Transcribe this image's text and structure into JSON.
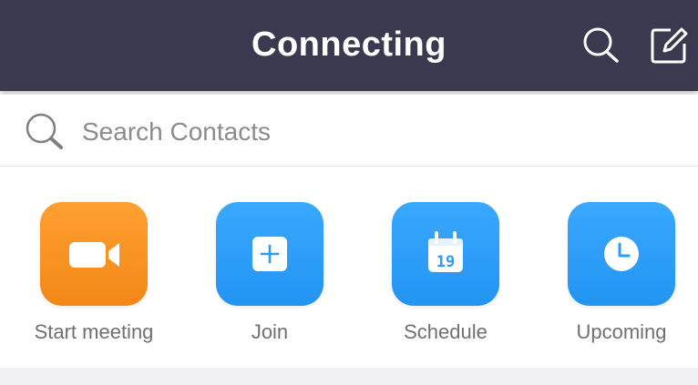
{
  "header": {
    "title": "Connecting",
    "background": "#3b3950",
    "icons": {
      "search": "search-icon",
      "compose": "compose-icon"
    }
  },
  "search": {
    "placeholder": "Search Contacts",
    "value": ""
  },
  "actions": [
    {
      "label": "Start meeting",
      "icon": "video-camera-icon",
      "color": "#f58b1a"
    },
    {
      "label": "Join",
      "icon": "plus-icon",
      "color": "#2b9cf7"
    },
    {
      "label": "Schedule",
      "icon": "calendar-icon",
      "calendar_day": "19",
      "color": "#2b9cf7"
    },
    {
      "label": "Upcoming",
      "icon": "clock-icon",
      "color": "#2b9cf7"
    }
  ]
}
